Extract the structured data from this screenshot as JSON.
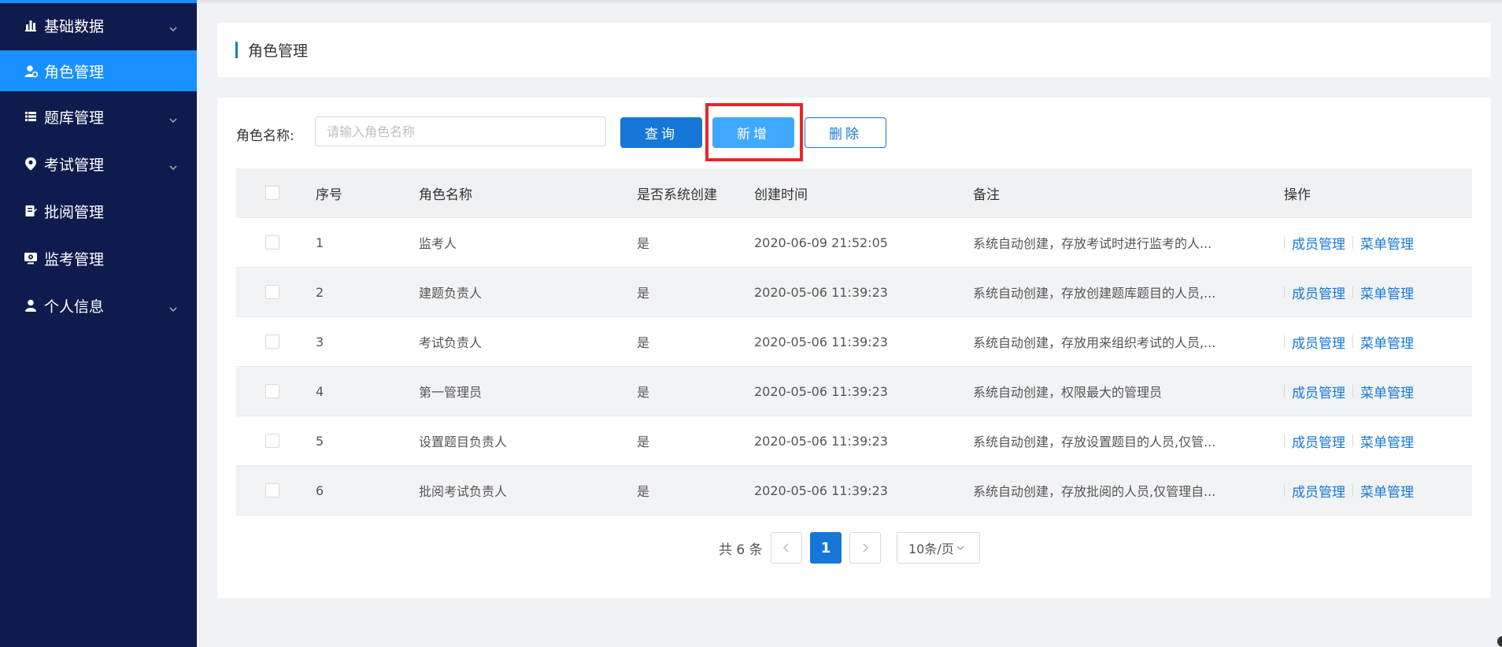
{
  "sidebar": {
    "items": [
      {
        "label": "基础数据",
        "icon": "bar-chart-icon",
        "expandable": true,
        "active": false
      },
      {
        "label": "角色管理",
        "icon": "user-role-icon",
        "expandable": false,
        "active": true
      },
      {
        "label": "题库管理",
        "icon": "list-icon",
        "expandable": true,
        "active": false
      },
      {
        "label": "考试管理",
        "icon": "location-pin-icon",
        "expandable": true,
        "active": false
      },
      {
        "label": "批阅管理",
        "icon": "document-edit-icon",
        "expandable": false,
        "active": false
      },
      {
        "label": "监考管理",
        "icon": "monitor-eye-icon",
        "expandable": false,
        "active": false
      },
      {
        "label": "个人信息",
        "icon": "person-icon",
        "expandable": true,
        "active": false
      }
    ]
  },
  "page": {
    "title": "角色管理"
  },
  "search": {
    "label": "角色名称:",
    "placeholder": "请输入角色名称",
    "value": ""
  },
  "toolbar": {
    "query_label": "查询",
    "add_label": "新增",
    "delete_label": "删除"
  },
  "table": {
    "headers": {
      "index": "序号",
      "name": "角色名称",
      "system": "是否系统创建",
      "created": "创建时间",
      "remark": "备注",
      "ops": "操作"
    },
    "rows": [
      {
        "index": "1",
        "name": "监考人",
        "system": "是",
        "created": "2020-06-09 21:52:05",
        "remark": "系统自动创建，存放考试时进行监考的人..."
      },
      {
        "index": "2",
        "name": "建题负责人",
        "system": "是",
        "created": "2020-05-06 11:39:23",
        "remark": "系统自动创建，存放创建题库题目的人员,..."
      },
      {
        "index": "3",
        "name": "考试负责人",
        "system": "是",
        "created": "2020-05-06 11:39:23",
        "remark": "系统自动创建，存放用来组织考试的人员,..."
      },
      {
        "index": "4",
        "name": "第一管理员",
        "system": "是",
        "created": "2020-05-06 11:39:23",
        "remark": "系统自动创建，权限最大的管理员"
      },
      {
        "index": "5",
        "name": "设置题目负责人",
        "system": "是",
        "created": "2020-05-06 11:39:23",
        "remark": "系统自动创建，存放设置题目的人员,仅管..."
      },
      {
        "index": "6",
        "name": "批阅考试负责人",
        "system": "是",
        "created": "2020-05-06 11:39:23",
        "remark": "系统自动创建，存放批阅的人员,仅管理自..."
      }
    ],
    "op_member_label": "成员管理",
    "op_menu_label": "菜单管理"
  },
  "pagination": {
    "total_text": "共 6 条",
    "current_page": "1",
    "page_size": "10条/页"
  },
  "colors": {
    "sidebar_bg": "#101b4d",
    "active_item": "#1890ff",
    "primary": "#1677d9",
    "highlight": "#e8262a"
  }
}
